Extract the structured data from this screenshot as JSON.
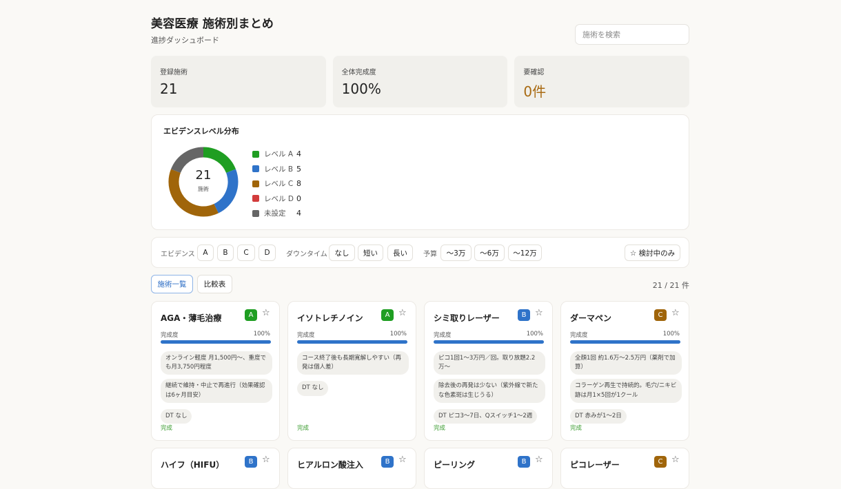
{
  "header": {
    "title": "美容医療 施術別まとめ",
    "subtitle": "進捗ダッシュボード",
    "search_placeholder": "施術を検索"
  },
  "stats": [
    {
      "label": "登録施術",
      "value": "21"
    },
    {
      "label": "全体完成度",
      "value": "100%"
    },
    {
      "label": "要確認",
      "value": "0件"
    }
  ],
  "evidence": {
    "title": "エビデンスレベル分布",
    "total": "21",
    "total_label": "施術",
    "legend": [
      {
        "label": "レベル A",
        "count": "4",
        "color": "#1f9e22"
      },
      {
        "label": "レベル B",
        "count": "5",
        "color": "#2f73c9"
      },
      {
        "label": "レベル C",
        "count": "8",
        "color": "#a0650a"
      },
      {
        "label": "レベル D",
        "count": "0",
        "color": "#d23c3c"
      },
      {
        "label": "未設定",
        "count": "4",
        "color": "#666666"
      }
    ]
  },
  "filters": {
    "evidence_label": "エビデンス",
    "evidence_options": [
      "A",
      "B",
      "C",
      "D"
    ],
    "downtime_label": "ダウンタイム",
    "downtime_options": [
      "なし",
      "短い",
      "長い"
    ],
    "budget_label": "予算",
    "budget_options": [
      "〜3万",
      "〜6万",
      "〜12万"
    ],
    "watchlist_label": "☆ 検討中のみ"
  },
  "tabs": {
    "list": "施術一覧",
    "compare": "比較表"
  },
  "result_count": "21 / 21 件",
  "progress_label": "完成度",
  "cards": [
    {
      "title": "AGA・薄毛治療",
      "level": "A",
      "level_color": "#1f9e22",
      "progress": "100%",
      "progress_value": 1.0,
      "chips": [
        "オンライン軽度 月1,500円〜、重度でも月3,750円程度",
        "継続で維持・中止で再進行（効果確認は6ヶ月目安）"
      ],
      "dt": "DT なし",
      "status": "完成"
    },
    {
      "title": "イソトレチノイン",
      "level": "A",
      "level_color": "#1f9e22",
      "progress": "100%",
      "progress_value": 1.0,
      "chips": [
        "コース終了後も長期寛解しやすい（再発は個人差）"
      ],
      "dt": "DT なし",
      "status": "完成"
    },
    {
      "title": "シミ取りレーザー",
      "level": "B",
      "level_color": "#2f73c9",
      "progress": "100%",
      "progress_value": 1.0,
      "chips": [
        "ピコ1回1〜3万円／回。取り放題2.2万〜",
        "除去後の再発は少ない（紫外線で新たな色素斑は生じうる）"
      ],
      "dt": "DT ピコ3〜7日、Qスイッチ1〜2週",
      "status": "完成"
    },
    {
      "title": "ダーマペン",
      "level": "C",
      "level_color": "#a0650a",
      "progress": "100%",
      "progress_value": 1.0,
      "chips": [
        "全顔1回 約1.6万〜2.5万円（薬剤で加算）",
        "コラーゲン再生で持続的。毛穴/ニキビ跡は月1×5回が1クール"
      ],
      "dt": "DT 赤みが1〜2日",
      "status": "完成"
    },
    {
      "title": "ハイフ（HIFU）",
      "level": "B",
      "level_color": "#2f73c9"
    },
    {
      "title": "ヒアルロン酸注入",
      "level": "B",
      "level_color": "#2f73c9"
    },
    {
      "title": "ピーリング",
      "level": "B",
      "level_color": "#2f73c9"
    },
    {
      "title": "ピコレーザー",
      "level": "C",
      "level_color": "#a0650a"
    }
  ]
}
